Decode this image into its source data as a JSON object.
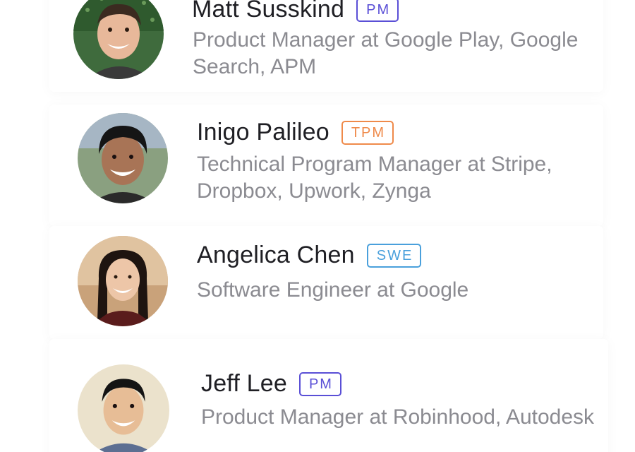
{
  "colors": {
    "pm_badge": "#5a4fd6",
    "tpm_badge": "#ef8a4a",
    "swe_badge": "#4aa0dc",
    "name_text": "#1f1f24",
    "desc_text": "#8b8b91"
  },
  "mentors": [
    {
      "name": "Matt Susskind",
      "role_badge": "PM",
      "description": "Product Manager at Google Play, Google Search, APM",
      "avatar_icon": "avatar-photo"
    },
    {
      "name": "Inigo Palileo",
      "role_badge": "TPM",
      "description": "Technical Program Manager at Stripe, Dropbox, Upwork, Zynga",
      "avatar_icon": "avatar-photo"
    },
    {
      "name": "Angelica Chen",
      "role_badge": "SWE",
      "description": "Software Engineer at Google",
      "avatar_icon": "avatar-photo"
    },
    {
      "name": "Jeff Lee",
      "role_badge": "PM",
      "description": "Product Manager at Robinhood, Autodesk",
      "avatar_icon": "avatar-photo"
    }
  ]
}
